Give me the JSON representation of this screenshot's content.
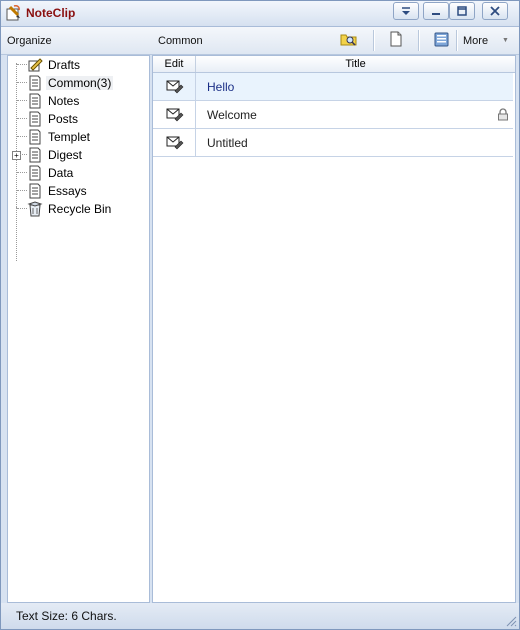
{
  "window": {
    "title": "NoteClip",
    "buttons": [
      "menu-dropdown",
      "minimize",
      "maximize",
      "close"
    ]
  },
  "toolbar": {
    "organize_label": "Organize",
    "current_folder": "Common",
    "more_label": "More"
  },
  "tree": {
    "items": [
      {
        "label": "Drafts",
        "icon": "pencil-note-icon"
      },
      {
        "label": "Common(3)",
        "icon": "document-icon",
        "selected": true
      },
      {
        "label": "Notes",
        "icon": "document-icon"
      },
      {
        "label": "Posts",
        "icon": "document-icon"
      },
      {
        "label": "Templet",
        "icon": "document-icon"
      },
      {
        "label": "Digest",
        "icon": "document-icon",
        "expandable": true
      },
      {
        "label": "Data",
        "icon": "document-icon"
      },
      {
        "label": "Essays",
        "icon": "document-icon"
      },
      {
        "label": "Recycle Bin",
        "icon": "recycle-bin-icon"
      }
    ]
  },
  "list": {
    "columns": {
      "edit": "Edit",
      "title": "Title"
    },
    "rows": [
      {
        "title": "Hello",
        "selected": true,
        "locked": false
      },
      {
        "title": "Welcome",
        "selected": false,
        "locked": true
      },
      {
        "title": "Untitled",
        "selected": false,
        "locked": false
      }
    ]
  },
  "status": {
    "text": "Text Size: 6 Chars."
  },
  "colors": {
    "accent": "#7f98bd",
    "selected_row": "#e9f3fd",
    "title_text": "#8a1010"
  }
}
